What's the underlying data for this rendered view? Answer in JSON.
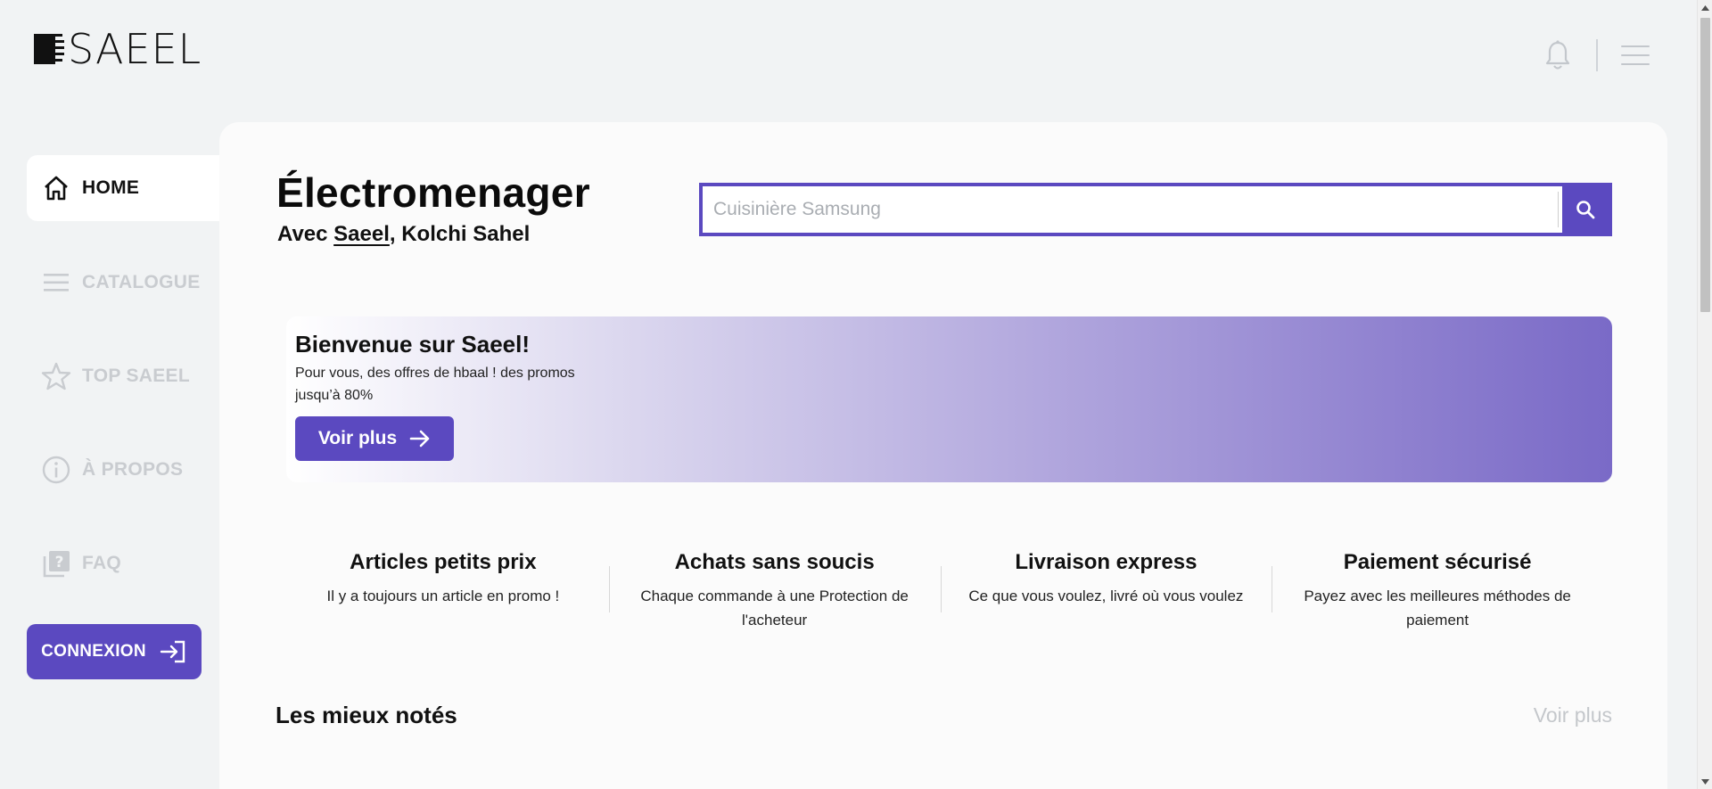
{
  "brand": {
    "name": "SAEEL"
  },
  "header": {
    "notifications_icon": "bell-icon",
    "menu_icon": "hamburger-icon"
  },
  "sidebar": {
    "items": [
      {
        "label": "HOME",
        "icon": "home-icon",
        "active": true
      },
      {
        "label": "CATALOGUE",
        "icon": "list-icon",
        "active": false
      },
      {
        "label": "TOP SAEEL",
        "icon": "star-icon",
        "active": false
      },
      {
        "label": "À PROPOS",
        "icon": "info-icon",
        "active": false
      },
      {
        "label": "FAQ",
        "icon": "question-icon",
        "active": false
      }
    ],
    "login_label": "CONNEXION"
  },
  "main": {
    "title": "Électromenager",
    "subtitle_prefix": "Avec ",
    "subtitle_link": "Saeel",
    "subtitle_suffix": ", Kolchi Sahel",
    "search": {
      "placeholder": "Cuisinière Samsung",
      "value": ""
    },
    "banner": {
      "title": "Bienvenue sur Saeel!",
      "text": "Pour vous, des offres de hbaal ! des promos jusqu’à 80%",
      "button": "Voir plus"
    },
    "features": [
      {
        "title": "Articles petits prix",
        "text": "Il y a toujours un article en promo !"
      },
      {
        "title": "Achats sans soucis",
        "text": "Chaque commande à une Protection de l'acheteur"
      },
      {
        "title": "Livraison express",
        "text": "Ce que vous voulez, livré où vous voulez"
      },
      {
        "title": "Paiement sécurisé",
        "text": "Payez avec les meilleures méthodes de paiement"
      }
    ],
    "section": {
      "title": "Les mieux notés",
      "more": "Voir plus"
    }
  },
  "colors": {
    "accent": "#5b49c0",
    "background": "#f1f3f4",
    "panel": "#fbfbfb",
    "muted": "#c9ccd0"
  }
}
